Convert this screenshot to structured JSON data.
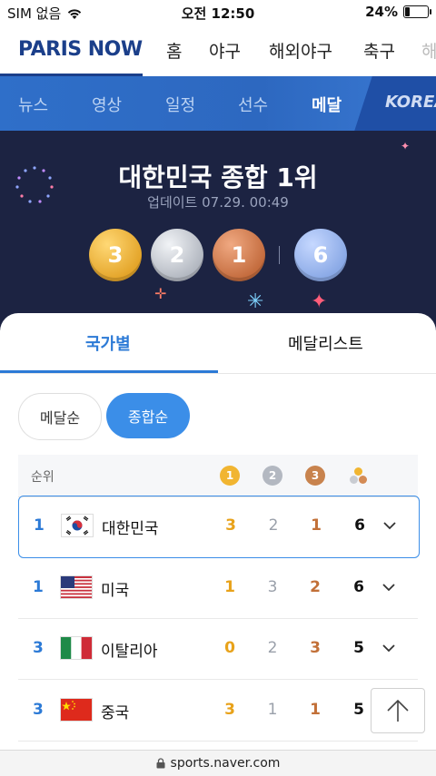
{
  "status_bar": {
    "carrier": "SIM 없음",
    "time": "오전 12:50",
    "battery_percent": "24%",
    "battery_level": 0.24
  },
  "main_nav": {
    "logo": "PARIS NOW",
    "items": [
      "홈",
      "야구",
      "해외야구",
      "축구",
      "해"
    ]
  },
  "sub_nav": {
    "items": [
      "뉴스",
      "영상",
      "일정",
      "선수",
      "메달"
    ],
    "active": "메달",
    "korea": "KOREA"
  },
  "hero": {
    "title": "대한민국 종합 1위",
    "update": "업데이트 07.29. 00:49",
    "medals": {
      "gold": "3",
      "silver": "2",
      "bronze": "1",
      "total": "6"
    }
  },
  "tabs": {
    "by_country": "국가별",
    "medalists": "메달리스트"
  },
  "sort": {
    "by_medal": "메달순",
    "by_total": "종합순"
  },
  "table": {
    "rank_header": "순위",
    "header_icons": {
      "gold": "1",
      "silver": "2",
      "bronze": "3"
    },
    "rows": [
      {
        "rank": "1",
        "country": "대한민국",
        "gold": "3",
        "silver": "2",
        "bronze": "1",
        "total": "6"
      },
      {
        "rank": "1",
        "country": "미국",
        "gold": "1",
        "silver": "3",
        "bronze": "2",
        "total": "6"
      },
      {
        "rank": "3",
        "country": "이탈리아",
        "gold": "0",
        "silver": "2",
        "bronze": "3",
        "total": "5"
      },
      {
        "rank": "3",
        "country": "중국",
        "gold": "3",
        "silver": "1",
        "bronze": "1",
        "total": "5"
      }
    ]
  },
  "url": "sports.naver.com",
  "colors": {
    "brand": "#1b3f8a",
    "accent": "#3b8ee8",
    "gold": "#e8a21a",
    "bronze": "#c27038",
    "hero_bg": "#1c2342"
  }
}
